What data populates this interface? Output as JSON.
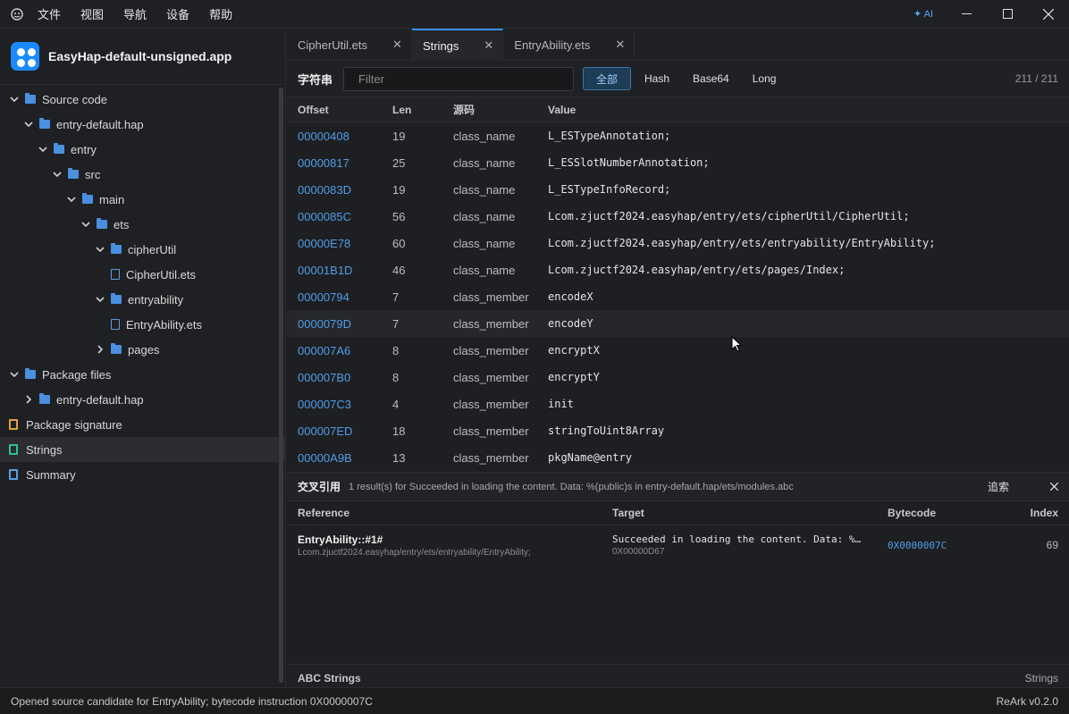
{
  "menu": {
    "items": [
      "文件",
      "视图",
      "导航",
      "设备",
      "帮助"
    ],
    "ai_label": "✦ AI"
  },
  "sidebar": {
    "project_title": "EasyHap-default-unsigned.app",
    "tree": [
      {
        "label": "Source code",
        "depth": 0,
        "kind": "folder",
        "expanded": true
      },
      {
        "label": "entry-default.hap",
        "depth": 1,
        "kind": "folder",
        "expanded": true
      },
      {
        "label": "entry",
        "depth": 2,
        "kind": "folder",
        "expanded": true
      },
      {
        "label": "src",
        "depth": 3,
        "kind": "folder",
        "expanded": true
      },
      {
        "label": "main",
        "depth": 4,
        "kind": "folder",
        "expanded": true
      },
      {
        "label": "ets",
        "depth": 5,
        "kind": "folder",
        "expanded": true
      },
      {
        "label": "cipherUtil",
        "depth": 6,
        "kind": "folder",
        "expanded": true
      },
      {
        "label": "CipherUtil.ets",
        "depth": 7,
        "kind": "file"
      },
      {
        "label": "entryability",
        "depth": 6,
        "kind": "folder",
        "expanded": true
      },
      {
        "label": "EntryAbility.ets",
        "depth": 7,
        "kind": "file"
      },
      {
        "label": "pages",
        "depth": 6,
        "kind": "folder",
        "expanded": false
      },
      {
        "label": "Package files",
        "depth": 0,
        "kind": "folder",
        "expanded": true
      },
      {
        "label": "entry-default.hap",
        "depth": 1,
        "kind": "folder",
        "expanded": false
      },
      {
        "label": "Package signature",
        "depth": 0,
        "kind": "sig"
      },
      {
        "label": "Strings",
        "depth": 0,
        "kind": "str",
        "selected": true
      },
      {
        "label": "Summary",
        "depth": 0,
        "kind": "sum"
      }
    ]
  },
  "tabs": [
    {
      "label": "CipherUtil.ets",
      "active": false
    },
    {
      "label": "Strings",
      "active": true
    },
    {
      "label": "EntryAbility.ets",
      "active": false
    }
  ],
  "toolbar": {
    "label": "字符串",
    "filter_placeholder": "Filter",
    "chips": [
      "全部",
      "Hash",
      "Base64",
      "Long"
    ],
    "count": "211 / 211"
  },
  "table": {
    "headers": [
      "Offset",
      "Len",
      "源码",
      "Value"
    ],
    "rows": [
      {
        "offset": "00000408",
        "len": "19",
        "src": "class_name",
        "value": "L_ESTypeAnnotation;"
      },
      {
        "offset": "00000817",
        "len": "25",
        "src": "class_name",
        "value": "L_ESSlotNumberAnnotation;"
      },
      {
        "offset": "0000083D",
        "len": "19",
        "src": "class_name",
        "value": "L_ESTypeInfoRecord;"
      },
      {
        "offset": "0000085C",
        "len": "56",
        "src": "class_name",
        "value": "Lcom.zjuctf2024.easyhap/entry/ets/cipherUtil/CipherUtil;"
      },
      {
        "offset": "00000E78",
        "len": "60",
        "src": "class_name",
        "value": "Lcom.zjuctf2024.easyhap/entry/ets/entryability/EntryAbility;"
      },
      {
        "offset": "00001B1D",
        "len": "46",
        "src": "class_name",
        "value": "Lcom.zjuctf2024.easyhap/entry/ets/pages/Index;"
      },
      {
        "offset": "00000794",
        "len": "7",
        "src": "class_member",
        "value": "encodeX"
      },
      {
        "offset": "0000079D",
        "len": "7",
        "src": "class_member",
        "value": "encodeY",
        "hover": true
      },
      {
        "offset": "000007A6",
        "len": "8",
        "src": "class_member",
        "value": "encryptX"
      },
      {
        "offset": "000007B0",
        "len": "8",
        "src": "class_member",
        "value": "encryptY"
      },
      {
        "offset": "000007C3",
        "len": "4",
        "src": "class_member",
        "value": "init"
      },
      {
        "offset": "000007ED",
        "len": "18",
        "src": "class_member",
        "value": "stringToUint8Array"
      },
      {
        "offset": "00000A9B",
        "len": "13",
        "src": "class_member",
        "value": "pkgName@entry"
      }
    ]
  },
  "xref": {
    "title": "交叉引用",
    "message": "1 result(s) for Succeeded in loading the content. Data: %(public)s in entry-default.hap/ets/modules.abc",
    "trace_label": "追索",
    "headers": [
      "Reference",
      "Target",
      "Bytecode",
      "Index"
    ],
    "rows": [
      {
        "ref": "EntryAbility::#1#",
        "ref_sub": "Lcom.zjuctf2024.easyhap/entry/ets/entryability/EntryAbility;",
        "target": "Succeeded in loading the content. Data: %…",
        "target_sub": "0X00000D67",
        "bytecode": "0X0000007C",
        "index": "69"
      }
    ],
    "footer_left": "ABC Strings",
    "footer_right": "Strings"
  },
  "status": {
    "left": "Opened source candidate for EntryAbility; bytecode instruction 0X0000007C",
    "right": "ReArk v0.2.0"
  }
}
